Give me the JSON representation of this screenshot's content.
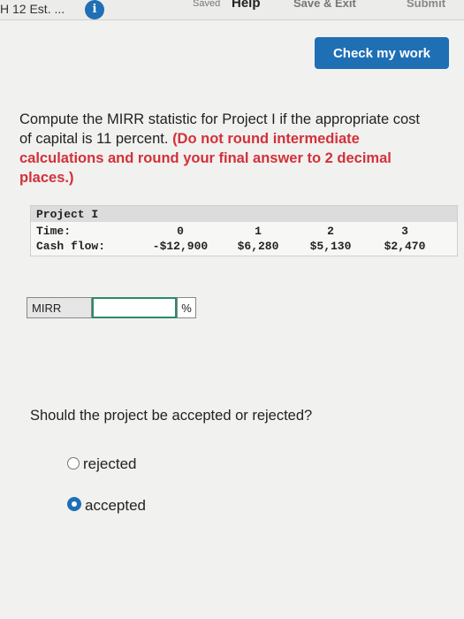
{
  "topbar": {
    "question_label": "H 12 Est. ...",
    "info_icon_glyph": "i",
    "saved_label": "Saved",
    "help_label": "Help",
    "save_exit_label": "Save & Exit",
    "submit_label": "Submit"
  },
  "check_button_label": "Check my work",
  "question": {
    "text": "Compute the MIRR statistic for Project I if the appropriate cost of capital is 11 percent.",
    "instruction": "(Do not round intermediate calculations and round your final answer to 2 decimal places.)"
  },
  "table": {
    "title": "Project I",
    "time_label": "Time:",
    "cash_label": "Cash flow:",
    "times": [
      "0",
      "1",
      "2",
      "3"
    ],
    "cash_flows": [
      "-$12,900",
      "$6,280",
      "$5,130",
      "$2,470"
    ]
  },
  "mirr": {
    "label": "MIRR",
    "value": "",
    "unit": "%"
  },
  "decision": {
    "prompt": "Should the project be accepted or rejected?",
    "options": [
      {
        "label": "rejected",
        "selected": false
      },
      {
        "label": "accepted",
        "selected": true
      }
    ]
  },
  "colors": {
    "accent": "#1f6fb5",
    "instruction_red": "#d2313a"
  }
}
